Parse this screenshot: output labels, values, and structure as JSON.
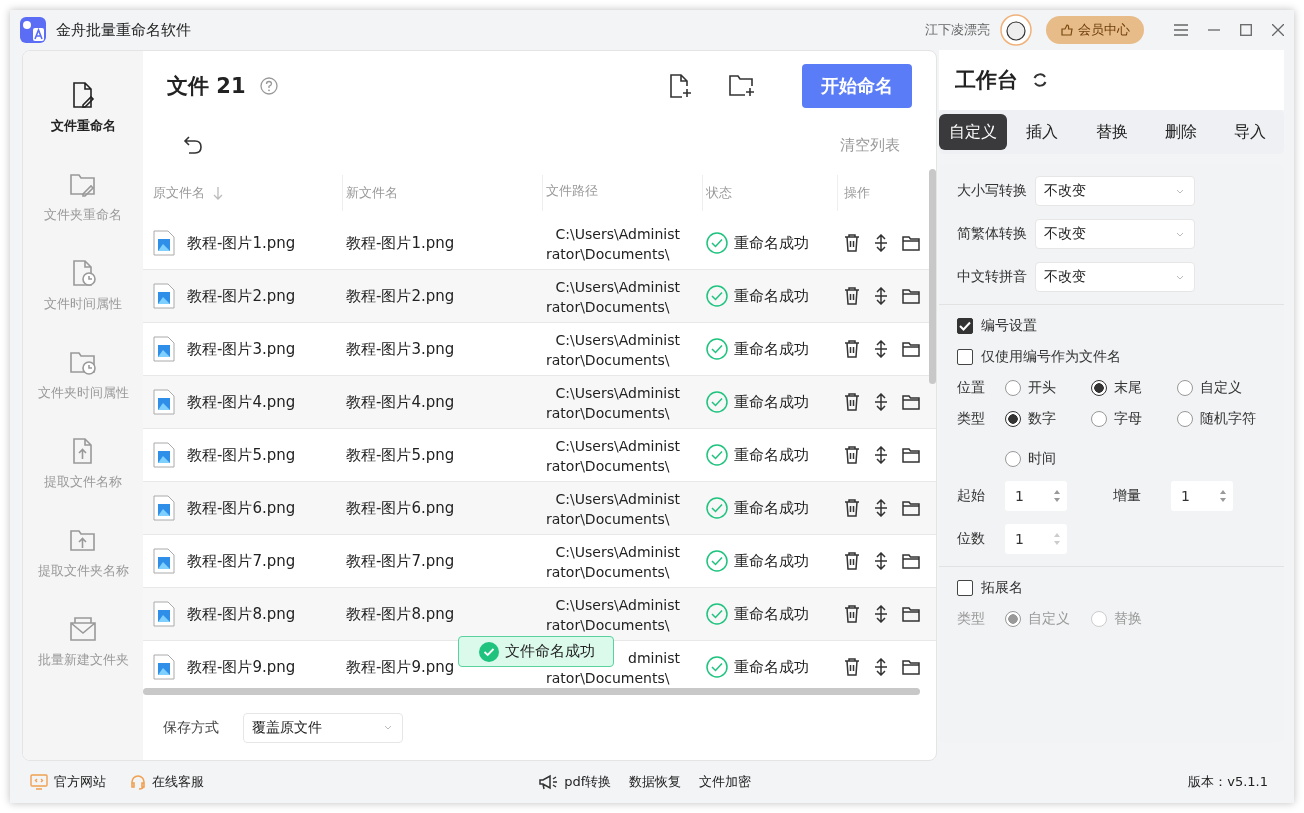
{
  "window": {
    "title": "金舟批量重命名软件",
    "user": "江下凌漂亮",
    "vip_button": "会员中心"
  },
  "sidebar": {
    "items": [
      {
        "label": "文件重命名",
        "kind": "file-edit",
        "selected": true
      },
      {
        "label": "文件夹重命名",
        "kind": "folder-edit",
        "selected": false
      },
      {
        "label": "文件时间属性",
        "kind": "file-clock",
        "selected": false
      },
      {
        "label": "文件夹时间属性",
        "kind": "folder-clock",
        "selected": false
      },
      {
        "label": "提取文件名称",
        "kind": "file-upload",
        "selected": false
      },
      {
        "label": "提取文件夹名称",
        "kind": "folder-upload",
        "selected": false
      },
      {
        "label": "批量新建文件夹",
        "kind": "mail",
        "selected": false
      }
    ]
  },
  "main": {
    "title": "文件 21",
    "start_button": "开始命名",
    "clear_button": "清空列表",
    "table": {
      "columns": [
        "原文件名",
        "新文件名",
        "文件路径",
        "状态",
        "操作"
      ],
      "rows": [
        {
          "original": "教程-图片1.png",
          "new": "教程-图片1.png",
          "path": [
            "C:\\Users\\Administ",
            "rator\\Documents\\"
          ],
          "status": "重命名成功"
        },
        {
          "original": "教程-图片2.png",
          "new": "教程-图片2.png",
          "path": [
            "C:\\Users\\Administ",
            "rator\\Documents\\"
          ],
          "status": "重命名成功"
        },
        {
          "original": "教程-图片3.png",
          "new": "教程-图片3.png",
          "path": [
            "C:\\Users\\Administ",
            "rator\\Documents\\"
          ],
          "status": "重命名成功"
        },
        {
          "original": "教程-图片4.png",
          "new": "教程-图片4.png",
          "path": [
            "C:\\Users\\Administ",
            "rator\\Documents\\"
          ],
          "status": "重命名成功"
        },
        {
          "original": "教程-图片5.png",
          "new": "教程-图片5.png",
          "path": [
            "C:\\Users\\Administ",
            "rator\\Documents\\"
          ],
          "status": "重命名成功"
        },
        {
          "original": "教程-图片6.png",
          "new": "教程-图片6.png",
          "path": [
            "C:\\Users\\Administ",
            "rator\\Documents\\"
          ],
          "status": "重命名成功"
        },
        {
          "original": "教程-图片7.png",
          "new": "教程-图片7.png",
          "path": [
            "C:\\Users\\Administ",
            "rator\\Documents\\"
          ],
          "status": "重命名成功"
        },
        {
          "original": "教程-图片8.png",
          "new": "教程-图片8.png",
          "path": [
            "C:\\Users\\Administ",
            "rator\\Documents\\"
          ],
          "status": "重命名成功"
        },
        {
          "original": "教程-图片9.png",
          "new": "教程-图片9.png",
          "path": [
            "dminist",
            "rator\\Documents\\"
          ],
          "status": "重命名成功"
        }
      ]
    },
    "toast": "文件命名成功",
    "save_mode": {
      "label": "保存方式",
      "value": "覆盖原文件"
    }
  },
  "workbench": {
    "title": "工作台",
    "tabs": [
      {
        "label": "自定义",
        "selected": true
      },
      {
        "label": "插入",
        "selected": false
      },
      {
        "label": "替换",
        "selected": false
      },
      {
        "label": "删除",
        "selected": false
      },
      {
        "label": "导入",
        "selected": false
      }
    ],
    "selects": [
      {
        "label": "大小写转换",
        "value": "不改变"
      },
      {
        "label": "简繁体转换",
        "value": "不改变"
      },
      {
        "label": "中文转拼音",
        "value": "不改变"
      }
    ],
    "numbering": {
      "label": "编号设置",
      "checked": true,
      "only_number": {
        "label": "仅使用编号作为文件名",
        "checked": false
      },
      "position": {
        "label": "位置",
        "options": [
          {
            "label": "开头",
            "selected": false
          },
          {
            "label": "末尾",
            "selected": true
          },
          {
            "label": "自定义",
            "selected": false
          }
        ]
      },
      "type": {
        "label": "类型",
        "options": [
          {
            "label": "数字",
            "selected": true
          },
          {
            "label": "字母",
            "selected": false
          },
          {
            "label": "随机字符",
            "selected": false
          },
          {
            "label": "时间",
            "selected": false
          }
        ]
      },
      "start": {
        "label": "起始",
        "value": "1"
      },
      "step": {
        "label": "增量",
        "value": "1"
      },
      "digits": {
        "label": "位数",
        "value": "1"
      }
    },
    "extension": {
      "label": "拓展名",
      "checked": false,
      "type": {
        "label": "类型",
        "disabled": true,
        "options": [
          {
            "label": "自定义",
            "selected": true
          },
          {
            "label": "替换",
            "selected": false
          }
        ]
      }
    }
  },
  "status_bar": {
    "links": [
      {
        "label": "官方网站",
        "kind": "monitor"
      },
      {
        "label": "在线客服",
        "kind": "headset"
      }
    ],
    "tools": [
      {
        "label": "pdf转换",
        "kind": "megaphone"
      },
      {
        "label": "数据恢复",
        "kind": "none"
      },
      {
        "label": "文件加密",
        "kind": "none"
      }
    ],
    "version": "版本：v5.1.1"
  }
}
